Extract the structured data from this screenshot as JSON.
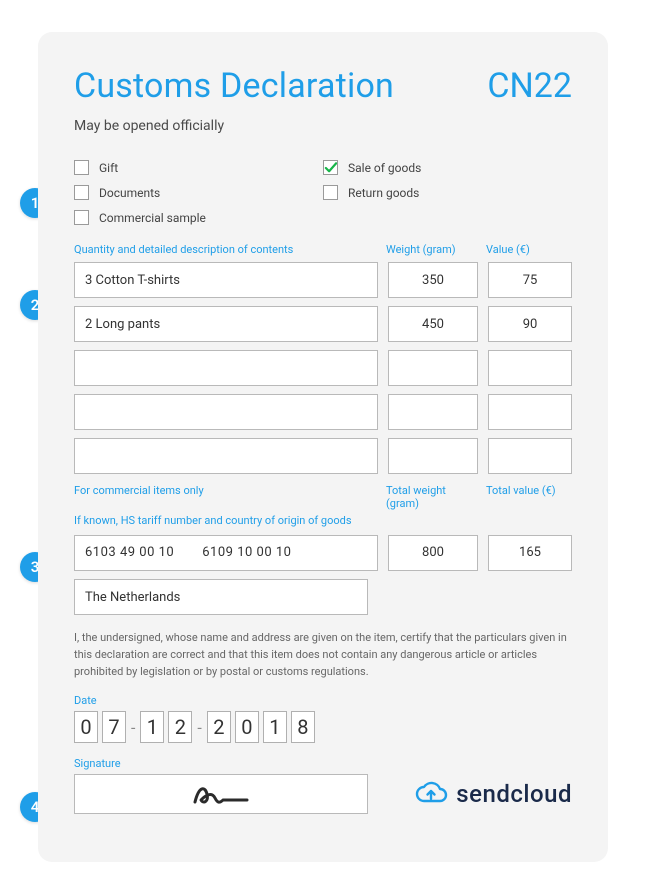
{
  "header": {
    "title": "Customs Declaration",
    "code": "CN22",
    "subtitle": "May be opened officially"
  },
  "badges": [
    "1",
    "2",
    "3",
    "4"
  ],
  "type_options": [
    {
      "label": "Gift",
      "checked": false
    },
    {
      "label": "Sale of goods",
      "checked": true
    },
    {
      "label": "Documents",
      "checked": false
    },
    {
      "label": "Return goods",
      "checked": false
    },
    {
      "label": "Commercial sample",
      "checked": false
    }
  ],
  "columns": {
    "desc": "Quantity and detailed description of contents",
    "weight": "Weight (gram)",
    "value": "Value (€)"
  },
  "items": [
    {
      "desc": "3 Cotton T-shirts",
      "weight": "350",
      "value": "75"
    },
    {
      "desc": "2 Long pants",
      "weight": "450",
      "value": "90"
    },
    {
      "desc": "",
      "weight": "",
      "value": ""
    },
    {
      "desc": "",
      "weight": "",
      "value": ""
    },
    {
      "desc": "",
      "weight": "",
      "value": ""
    }
  ],
  "section3": {
    "commercial_label": "For commercial items only",
    "hs_label": "If known, HS tariff number and country of origin of goods",
    "total_weight_label": "Total weight (gram)",
    "total_value_label": "Total value (€)",
    "hs1": "6103 49 00 10",
    "hs2": "6109 10 00 10",
    "total_weight": "800",
    "total_value": "165",
    "origin": "The Netherlands"
  },
  "certification": "I, the undersigned, whose name and address are given on the item, certify that the particulars given in this declaration are correct and that this item does not contain any dangerous article or articles prohibited by legislation or by postal or customs regulations.",
  "date": {
    "label": "Date",
    "digits": [
      "0",
      "7",
      "1",
      "2",
      "2",
      "0",
      "1",
      "8"
    ]
  },
  "signature": {
    "label": "Signature"
  },
  "brand": {
    "name": "sendcloud"
  }
}
